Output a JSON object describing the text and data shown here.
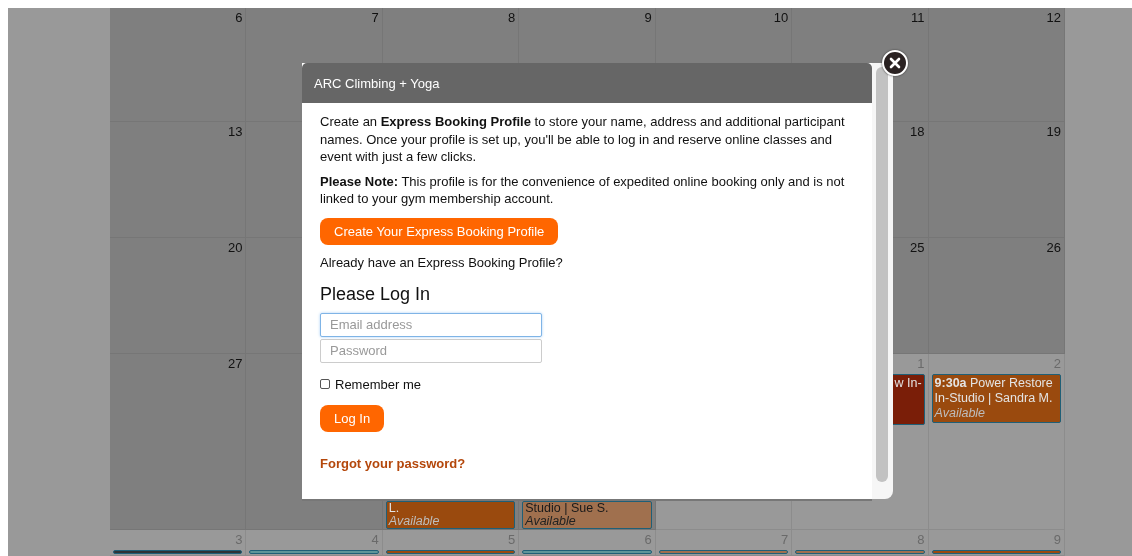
{
  "calendar": {
    "weeks": [
      [
        {
          "day": "6",
          "in_month": true
        },
        {
          "day": "7",
          "in_month": true
        },
        {
          "day": "8",
          "in_month": true
        },
        {
          "day": "9",
          "in_month": true
        },
        {
          "day": "10",
          "in_month": true
        },
        {
          "day": "11",
          "in_month": true
        },
        {
          "day": "12",
          "in_month": true
        }
      ],
      [
        {
          "day": "13",
          "in_month": true
        },
        {
          "in_month": true
        },
        {
          "day": "18",
          "in_month": true
        },
        {
          "day": "19",
          "in_month": true
        }
      ],
      [
        {
          "day": "20",
          "in_month": true
        },
        {
          "in_month": true
        },
        {
          "day": "25",
          "in_month": true
        },
        {
          "day": "26",
          "in_month": true
        }
      ],
      [
        {
          "day": "27",
          "in_month": true
        },
        {
          "in_month": true
        },
        {
          "events": [
            {
              "kind": "tail",
              "color": "#9a4a0e",
              "title": "L.",
              "status": "Available"
            }
          ]
        },
        {
          "events": [
            {
              "kind": "tail",
              "color": "#a0704e",
              "title": "Studio | Sue S.",
              "status": "Available"
            }
          ]
        },
        {
          "in_month": false
        },
        {
          "day": "1",
          "in_month": false,
          "events": [
            {
              "kind": "clip",
              "color": "#7a1e08",
              "title": "w In-"
            }
          ]
        },
        {
          "day": "2",
          "in_month": false,
          "events": [
            {
              "kind": "full",
              "color": "#9a4a0e",
              "time": "9:30a",
              "title": "Power Restore In-Studio | Sandra M.",
              "status": "Available"
            }
          ]
        }
      ],
      [
        {
          "day": "3",
          "in_month": false,
          "events": [
            {
              "kind": "stub",
              "color": "#2e3436"
            }
          ]
        },
        {
          "day": "4",
          "in_month": false,
          "events": [
            {
              "kind": "stub",
              "color": "#5e9599"
            }
          ]
        },
        {
          "day": "5",
          "in_month": false,
          "events": [
            {
              "kind": "stub",
              "color": "#9a4a0e"
            }
          ]
        },
        {
          "day": "6",
          "in_month": false,
          "events": [
            {
              "kind": "stub",
              "color": "#5e9599"
            }
          ]
        },
        {
          "day": "7",
          "in_month": false,
          "events": [
            {
              "kind": "stub",
              "color": "#a0704e"
            }
          ]
        },
        {
          "day": "8",
          "in_month": false,
          "events": [
            {
              "kind": "stub",
              "color": "#a0704e"
            }
          ]
        },
        {
          "day": "9",
          "in_month": false,
          "events": [
            {
              "kind": "stub",
              "color": "#9a4a0e"
            }
          ]
        }
      ]
    ]
  },
  "modal": {
    "title": "ARC Climbing + Yoga",
    "intro": "Create an **Express Booking Profile** to store your name, address and additional participant names. Once your profile is set up, you'll be able to log in and reserve online classes and event with just a few clicks.",
    "note": "**Please Note:** This profile is for the convenience of expedited online booking only and is not linked to your gym membership account.",
    "create_button": "Create Your Express Booking Profile",
    "already_text": "Already have an Express Booking Profile?",
    "login_heading": "Please Log In",
    "email_field": {
      "placeholder": "Email address",
      "focused": true
    },
    "password_field": {
      "placeholder": "Password",
      "focused": false
    },
    "remember_me": {
      "label": "Remember me",
      "checked": false
    },
    "login_button": "Log In",
    "forgot_link": "Forgot your password?"
  }
}
